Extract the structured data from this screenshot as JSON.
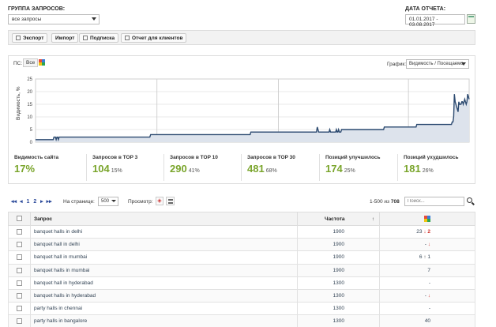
{
  "header": {
    "group_label": "ГРУППА ЗАПРОСОВ:",
    "group_value": "все запросы",
    "date_label": "ДАТА ОТЧЕТА:",
    "date_value": "01.01.2017 - 03.08.2017"
  },
  "toolbar": {
    "export": "Экспорт",
    "import": "Импорт",
    "subscribe": "Подписка",
    "client_report": "Отчет для клиентов"
  },
  "chart_panel": {
    "ps_label": "ПС:",
    "ps_all": "Все",
    "graph_label": "График:",
    "graph_select": "Видимость / Посещаемо"
  },
  "chart_data": {
    "type": "area",
    "ylabel": "Видимость, %",
    "ylim": [
      0,
      25
    ],
    "yticks": [
      "0",
      "5",
      "10",
      "15",
      "20",
      "25"
    ],
    "grid": true,
    "series": [
      {
        "values": [
          1,
          1,
          1,
          1,
          1,
          1,
          1,
          1,
          1,
          1,
          1,
          1,
          1,
          1,
          1,
          1,
          1,
          1,
          1,
          1,
          1,
          1,
          1,
          1,
          1,
          2,
          2,
          2,
          1,
          2,
          2,
          1,
          2,
          2,
          2,
          2,
          2,
          2,
          2,
          2,
          2,
          2,
          2,
          2,
          2,
          2,
          2,
          2,
          2,
          2,
          2,
          2,
          2,
          2,
          2,
          2,
          2,
          2,
          2,
          2,
          2,
          2,
          2,
          2,
          2,
          2,
          2,
          2,
          2,
          2,
          2,
          2,
          2,
          2,
          2,
          2,
          2,
          2,
          2,
          2,
          2,
          2,
          2,
          2,
          2,
          2,
          2,
          2,
          2,
          2,
          2,
          2,
          2,
          2,
          2,
          2,
          2,
          2,
          2,
          2,
          2,
          2,
          2,
          2,
          2,
          2,
          2,
          2,
          2,
          2,
          2,
          2,
          2,
          2,
          2,
          2,
          2,
          2,
          2,
          2,
          2,
          2,
          2,
          2,
          2,
          2,
          2,
          2,
          2,
          2,
          2,
          2,
          2,
          2,
          2,
          2,
          2,
          2,
          2,
          2,
          2,
          2,
          2,
          2,
          2,
          2,
          2,
          2,
          2,
          2,
          2,
          2,
          2,
          2,
          2,
          2,
          3,
          3,
          3,
          3,
          3,
          3,
          3,
          3,
          3,
          3,
          3,
          3,
          3,
          3,
          3,
          3,
          3,
          3,
          3,
          3,
          3,
          3,
          3,
          3,
          3,
          3,
          3,
          3,
          3,
          3,
          3,
          3,
          3,
          3,
          3,
          3,
          3,
          3,
          3,
          3,
          3,
          3,
          3,
          3,
          3,
          3,
          3,
          3,
          3,
          3,
          3,
          3,
          3,
          3,
          3,
          3,
          3,
          3,
          3,
          3,
          3,
          3,
          3,
          3,
          3,
          3,
          3,
          3,
          3,
          3,
          3,
          3,
          3,
          3,
          3,
          3,
          3,
          3,
          3,
          3,
          3,
          3,
          3,
          3,
          3,
          3,
          3,
          3,
          3,
          3,
          3,
          3,
          3,
          3,
          3,
          3,
          3,
          3,
          3,
          3,
          3,
          3,
          3,
          3,
          3,
          3,
          3,
          3,
          3,
          3,
          3,
          3,
          3,
          3,
          3,
          3,
          3,
          3,
          3,
          3,
          3,
          3,
          3,
          3,
          3,
          3,
          3,
          3,
          3,
          3,
          3,
          3,
          3,
          3,
          3,
          3,
          4,
          4,
          4,
          4,
          4,
          4,
          4,
          4,
          4,
          4,
          4,
          4,
          4,
          4,
          4,
          4,
          4,
          4,
          4,
          4,
          4,
          4,
          4,
          4,
          4,
          4,
          4,
          4,
          4,
          4,
          4,
          4,
          4,
          4,
          4,
          4,
          4,
          4,
          4,
          4,
          4,
          4,
          4,
          4,
          4,
          4,
          4,
          4,
          4,
          4,
          4,
          4,
          4,
          4,
          4,
          4,
          4,
          4,
          4,
          4,
          4,
          4,
          4,
          4,
          4,
          4,
          4,
          4,
          4,
          4,
          4,
          4,
          4,
          4,
          4,
          4,
          4,
          4,
          4,
          4,
          4,
          4,
          4,
          4,
          4,
          4,
          4,
          4,
          4,
          4,
          6,
          5,
          4,
          4,
          4,
          4,
          4,
          4,
          4,
          4,
          4,
          4,
          4,
          4,
          4,
          4,
          4,
          5,
          4,
          4,
          4,
          4,
          4,
          4,
          4,
          4,
          5,
          4,
          4,
          5,
          4,
          4,
          4,
          5,
          5,
          5,
          5,
          5,
          5,
          5,
          5,
          5,
          5,
          5,
          5,
          5,
          5,
          5,
          5,
          5,
          5,
          5,
          5,
          5,
          5,
          5,
          5,
          5,
          5,
          5,
          5,
          5,
          5,
          5,
          5,
          5,
          5,
          5,
          5,
          5,
          5,
          5,
          5,
          5,
          5,
          5,
          5,
          5,
          5,
          5,
          5,
          5,
          5,
          5,
          5,
          5,
          5,
          5,
          5,
          5,
          5,
          6,
          6,
          6,
          6,
          6,
          6,
          6,
          6,
          6,
          6,
          6,
          6,
          6,
          6,
          6,
          6,
          6,
          6,
          6,
          6,
          6,
          6,
          6,
          6,
          6,
          6,
          6,
          6,
          6,
          6,
          6,
          6,
          6,
          6,
          6,
          6,
          6,
          6,
          6,
          6,
          6,
          6,
          6,
          6,
          7,
          7,
          7,
          7,
          7,
          7,
          7,
          7,
          7,
          7,
          7,
          7,
          7,
          7,
          7,
          7,
          7,
          7,
          7,
          7,
          7,
          7,
          7,
          7,
          7,
          7,
          7,
          7,
          7,
          7,
          7,
          7,
          7,
          7,
          7,
          7,
          7,
          7,
          7,
          7,
          7,
          7,
          7,
          7,
          7,
          7,
          7,
          7,
          8,
          8,
          10,
          19,
          16,
          15,
          14,
          13,
          12,
          16,
          15,
          15,
          15,
          16,
          16,
          15,
          16,
          17,
          16,
          15,
          16,
          19,
          18,
          17
        ]
      }
    ]
  },
  "stats": [
    {
      "name": "Видимость сайта",
      "value": "17%",
      "pct": ""
    },
    {
      "name": "Запросов в TOP 3",
      "value": "104",
      "pct": "15%"
    },
    {
      "name": "Запросов в TOP 10",
      "value": "290",
      "pct": "41%"
    },
    {
      "name": "Запросов в TOP 30",
      "value": "481",
      "pct": "68%"
    },
    {
      "name": "Позиций улучшилось",
      "value": "174",
      "pct": "25%"
    },
    {
      "name": "Позиций ухудшилось",
      "value": "181",
      "pct": "26%"
    }
  ],
  "pagination": {
    "page1": "1",
    "page2": "2",
    "per_page_label": "На странице:",
    "per_page_value": "500",
    "view_label": "Просмотр:",
    "range": "1-500 из",
    "total": "708",
    "search_placeholder": "Поиск..."
  },
  "table": {
    "columns": {
      "query": "Запрос",
      "freq": "Частота",
      "sort": "↑"
    },
    "rows": [
      {
        "query": "banquet halls in delhi",
        "freq": "1900",
        "pos": "23",
        "arrow": "↓",
        "arrow_dir": "down",
        "change": "2"
      },
      {
        "query": "banquet hall in delhi",
        "freq": "1900",
        "pos": "-",
        "arrow": "↓",
        "arrow_dir": "down",
        "change": ""
      },
      {
        "query": "banquet hall in mumbai",
        "freq": "1900",
        "pos": "6",
        "arrow": "↑",
        "arrow_dir": "up",
        "change": "1"
      },
      {
        "query": "banquet halls in mumbai",
        "freq": "1900",
        "pos": "7",
        "arrow": "",
        "arrow_dir": "",
        "change": ""
      },
      {
        "query": "banquet hall in hyderabad",
        "freq": "1300",
        "pos": "-",
        "arrow": "",
        "arrow_dir": "",
        "change": ""
      },
      {
        "query": "banquet halls in hyderabad",
        "freq": "1300",
        "pos": "-",
        "arrow": "↓",
        "arrow_dir": "down",
        "change": ""
      },
      {
        "query": "party halls in chennai",
        "freq": "1300",
        "pos": "-",
        "arrow": "",
        "arrow_dir": "",
        "change": ""
      },
      {
        "query": "party halls in bangalore",
        "freq": "1300",
        "pos": "40",
        "arrow": "",
        "arrow_dir": "",
        "change": ""
      }
    ]
  }
}
